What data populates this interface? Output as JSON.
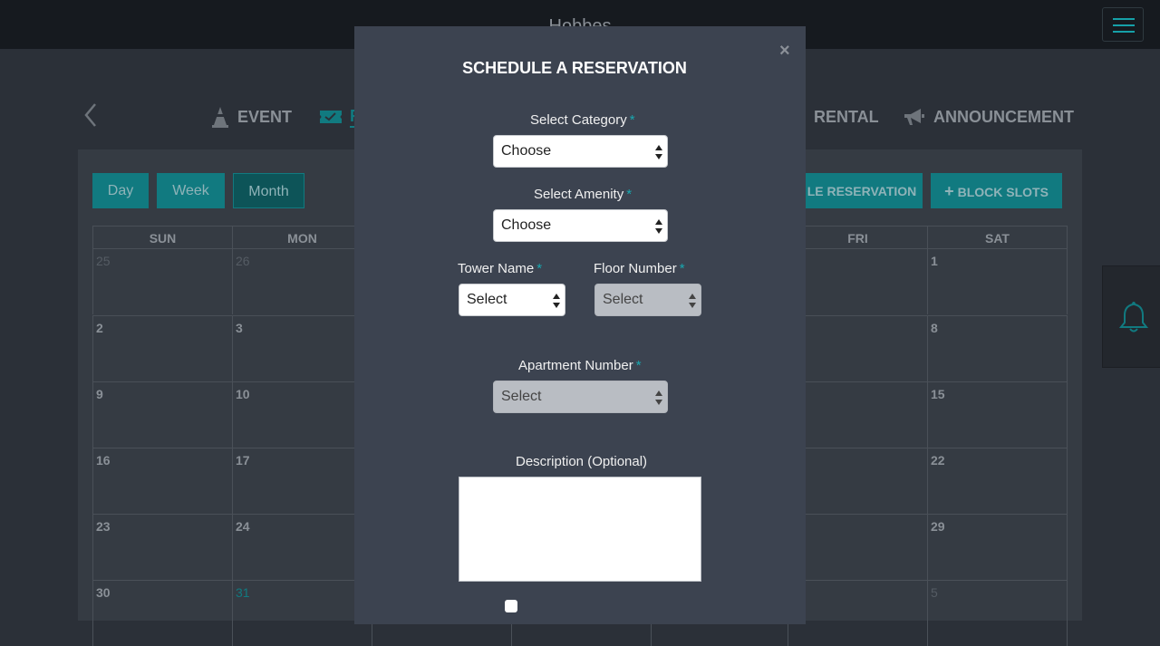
{
  "app": {
    "title": "Hobbes"
  },
  "nav_types": [
    {
      "label": "EVENT",
      "icon": "cone-icon"
    },
    {
      "label": "R",
      "icon": "ticket-icon"
    },
    {
      "label": "RENTAL",
      "icon": ""
    },
    {
      "label": "ANNOUNCEMENT",
      "icon": "megaphone-icon"
    }
  ],
  "views": {
    "day": "Day",
    "week": "Week",
    "month": "Month",
    "active": "Month"
  },
  "actions": {
    "schedule_reservation": "LE RESERVATION",
    "block_slots": "BLOCK SLOTS"
  },
  "calendar": {
    "headers": [
      "SUN",
      "MON",
      "",
      "",
      "",
      "FRI",
      "SAT"
    ],
    "weeks": [
      [
        {
          "d": "25",
          "m": true
        },
        {
          "d": "26",
          "m": true
        },
        {
          "d": ""
        },
        {
          "d": ""
        },
        {
          "d": ""
        },
        {
          "d": ""
        },
        {
          "d": "1"
        }
      ],
      [
        {
          "d": "2"
        },
        {
          "d": "3"
        },
        {
          "d": ""
        },
        {
          "d": ""
        },
        {
          "d": ""
        },
        {
          "d": ""
        },
        {
          "d": "8"
        }
      ],
      [
        {
          "d": "9"
        },
        {
          "d": "10"
        },
        {
          "d": ""
        },
        {
          "d": ""
        },
        {
          "d": ""
        },
        {
          "d": ""
        },
        {
          "d": "15"
        }
      ],
      [
        {
          "d": "16"
        },
        {
          "d": "17"
        },
        {
          "d": ""
        },
        {
          "d": ""
        },
        {
          "d": ""
        },
        {
          "d": ""
        },
        {
          "d": "22"
        }
      ],
      [
        {
          "d": "23"
        },
        {
          "d": "24"
        },
        {
          "d": ""
        },
        {
          "d": ""
        },
        {
          "d": ""
        },
        {
          "d": ""
        },
        {
          "d": "29"
        }
      ],
      [
        {
          "d": "30"
        },
        {
          "d": "31",
          "t": true
        },
        {
          "d": ""
        },
        {
          "d": ""
        },
        {
          "d": ""
        },
        {
          "d": ""
        },
        {
          "d": "5",
          "m": true
        }
      ]
    ]
  },
  "modal": {
    "close": "×",
    "title": "SCHEDULE A RESERVATION",
    "required_marker": "*",
    "fields": {
      "category": {
        "label": "Select Category",
        "value": "Choose"
      },
      "amenity": {
        "label": "Select Amenity",
        "value": "Choose"
      },
      "tower": {
        "label": "Tower Name",
        "value": "Select"
      },
      "floor": {
        "label": "Floor Number",
        "value": "Select"
      },
      "apartment": {
        "label": "Apartment Number",
        "value": "Select"
      },
      "description": {
        "label": "Description (Optional)",
        "value": ""
      }
    }
  },
  "colors": {
    "accent": "#117a80",
    "modal_bg": "#3c4350",
    "page_bg": "#2b3038"
  }
}
